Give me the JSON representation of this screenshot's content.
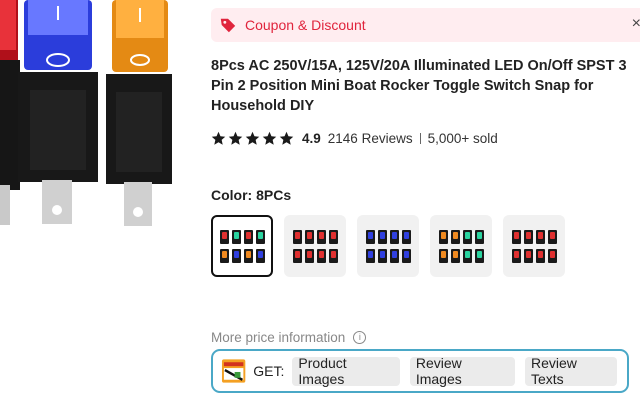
{
  "coupon": {
    "label": "Coupon & Discount",
    "close": "×"
  },
  "product": {
    "title_lines": [
      "8Pcs AC 250V/15A, 125V/20A Illuminated LED On/Off SPST 3",
      "Pin 2 Position Mini Boat Rocker Toggle Switch Snap for",
      "Household DIY"
    ]
  },
  "rating": {
    "score": "4.9",
    "reviews": "2146 Reviews",
    "sold": "5,000+ sold",
    "stars": 5
  },
  "color": {
    "label": "Color: 8PCs"
  },
  "swatches": [
    {
      "selected": true,
      "colors": [
        "#e03030",
        "#2ad4a0",
        "#e03030",
        "#2ad4a0",
        "#f08a20",
        "#3040e0",
        "#f08a20",
        "#3040e0"
      ]
    },
    {
      "selected": false,
      "colors": [
        "#e03030",
        "#e03030",
        "#e03030",
        "#e03030",
        "#e03030",
        "#e03030",
        "#e03030",
        "#e03030"
      ]
    },
    {
      "selected": false,
      "colors": [
        "#3040e0",
        "#3040e0",
        "#3040e0",
        "#3040e0",
        "#3040e0",
        "#3040e0",
        "#3040e0",
        "#3040e0"
      ]
    },
    {
      "selected": false,
      "colors": [
        "#f08a20",
        "#f08a20",
        "#2ad4a0",
        "#2ad4a0",
        "#f08a20",
        "#f08a20",
        "#2ad4a0",
        "#2ad4a0"
      ]
    },
    {
      "selected": false,
      "colors": [
        "#e03030",
        "#e03030",
        "#e03030",
        "#e03030",
        "#e03030",
        "#e03030",
        "#e03030",
        "#e03030"
      ]
    }
  ],
  "more_price": {
    "label": "More price information",
    "info_icon": "ⓘ"
  },
  "get_bar": {
    "label": "GET:",
    "buttons": [
      "Product Images",
      "Review Images",
      "Review Texts"
    ]
  },
  "colors": {
    "accent": "#e0243c",
    "coupon_bg": "#ffedf0",
    "get_border": "#4aa8c7",
    "star": "#1a1a1a"
  }
}
